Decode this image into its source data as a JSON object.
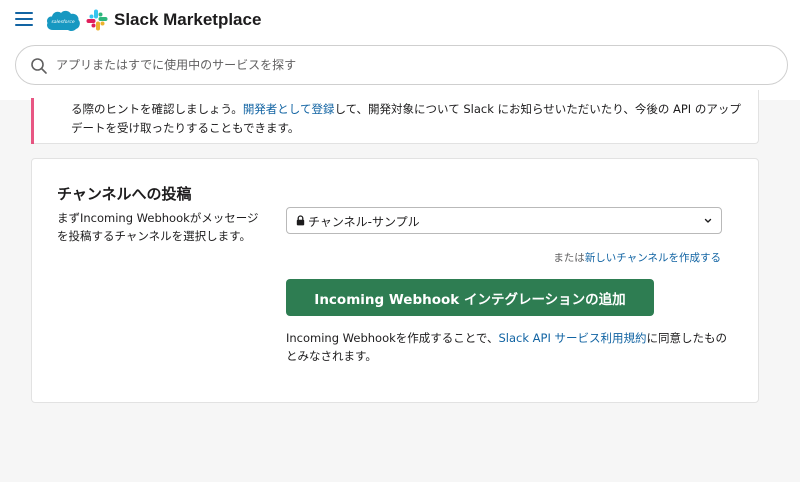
{
  "header": {
    "menu_label": "menu",
    "salesforce_text": "salesforce",
    "brand": "Slack Marketplace",
    "search_placeholder": "アプリまたはすでに使用中のサービスを探す"
  },
  "notice": {
    "text_1": "る際のヒントを確認しましょう。",
    "link": "開発者として登録",
    "text_2": "して、開発対象について Slack にお知らせいただいたり、今後の API のアップデートを受け取ったりすることもできます。"
  },
  "post_section": {
    "title": "チャンネルへの投稿",
    "description": "まずIncoming Webhookがメッセージを投稿するチャンネルを選択します。",
    "selected_channel": "チャンネル-サンプル",
    "alt_prefix": "または",
    "alt_link": "新しいチャンネルを作成する",
    "button_label": "Incoming Webhook インテグレーションの追加",
    "terms_prefix": "Incoming Webhookを作成することで、",
    "terms_link": "Slack API サービス利用規約",
    "terms_suffix": "に同意したものとみなされます。"
  },
  "colors": {
    "accent_link": "#1264a3",
    "button_green": "#2e7d52",
    "notice_bar": "#e01e5a"
  }
}
